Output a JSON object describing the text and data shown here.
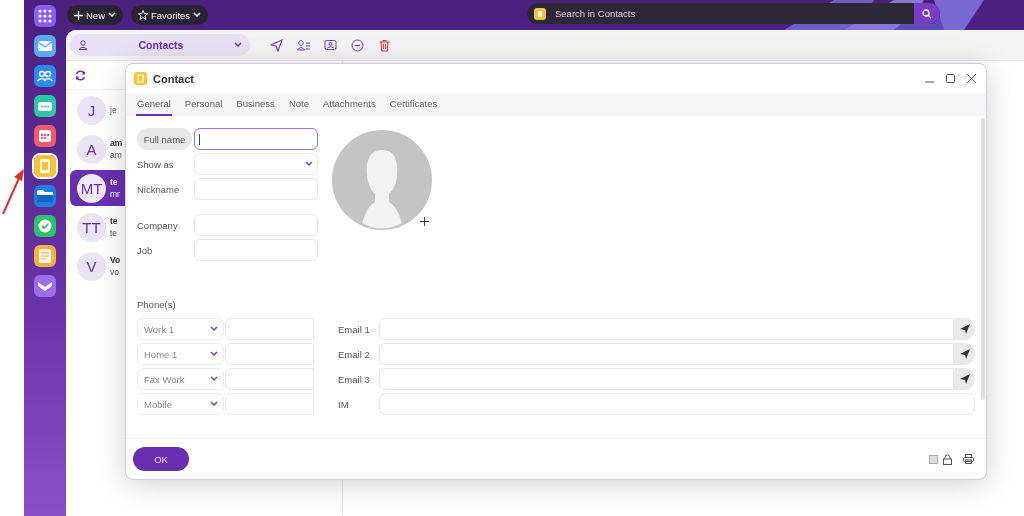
{
  "top_bar": {
    "new_button": "New",
    "favorites_button": "Favorites",
    "search": {
      "placeholder": "Search in Contacts"
    }
  },
  "sidebar": {
    "apps": [
      {
        "kind": "apps",
        "color": "#8b5cf6",
        "selected": false
      },
      {
        "kind": "mail",
        "color": "#5aa9f5",
        "selected": false
      },
      {
        "kind": "contacts",
        "color": "#2a8cf0",
        "selected": false
      },
      {
        "kind": "video",
        "color": "#2ec4a6",
        "selected": false
      },
      {
        "kind": "calendar",
        "color": "#f15b6c",
        "selected": false
      },
      {
        "kind": "address-book",
        "color": "#f8c33a",
        "selected": true
      },
      {
        "kind": "folder",
        "color": "#1a7fe0",
        "selected": false
      },
      {
        "kind": "tasks",
        "color": "#2fc16b",
        "selected": false
      },
      {
        "kind": "notes",
        "color": "#f7b23b",
        "selected": false
      },
      {
        "kind": "chevron",
        "color": "#9b6ef0",
        "selected": false
      }
    ]
  },
  "toolbar": {
    "folder": "Contacts"
  },
  "contact_list": [
    {
      "initials": "J",
      "title": "je",
      "selected": false
    },
    {
      "initials": "A",
      "title": "am",
      "subtitle": "am",
      "selected": false
    },
    {
      "initials": "MT",
      "title": "te",
      "subtitle": "mr",
      "selected": true
    },
    {
      "initials": "TT",
      "title": "te",
      "subtitle": "te",
      "selected": false
    },
    {
      "initials": "V",
      "title": "Vo",
      "subtitle": "vo",
      "selected": false
    }
  ],
  "dialog": {
    "title": "Contact",
    "tabs": [
      {
        "label": "General",
        "selected": true
      },
      {
        "label": "Personal",
        "selected": false
      },
      {
        "label": "Business",
        "selected": false
      },
      {
        "label": "Note",
        "selected": false
      },
      {
        "label": "Attachments",
        "selected": false
      },
      {
        "label": "Certificates",
        "selected": false
      }
    ],
    "name_fields": [
      {
        "label": "Full name",
        "kind": "text",
        "focused": true
      },
      {
        "label": "Show as",
        "kind": "select",
        "focused": false
      },
      {
        "label": "Nickname",
        "kind": "text",
        "focused": false
      }
    ],
    "work_fields": [
      {
        "label": "Company",
        "kind": "text",
        "focused": false
      },
      {
        "label": "Job",
        "kind": "text",
        "focused": false
      }
    ],
    "phones_label": "Phone(s)",
    "phones": [
      {
        "type": "Work 1"
      },
      {
        "type": "Home 1"
      },
      {
        "type": "Fax Work"
      },
      {
        "type": "Mobile"
      }
    ],
    "addresses": [
      {
        "label": "Email 1",
        "kind": "email"
      },
      {
        "label": "Email 2",
        "kind": "email"
      },
      {
        "label": "Email 3",
        "kind": "email"
      },
      {
        "label": "IM",
        "kind": "im"
      }
    ],
    "ok_button": "OK"
  }
}
